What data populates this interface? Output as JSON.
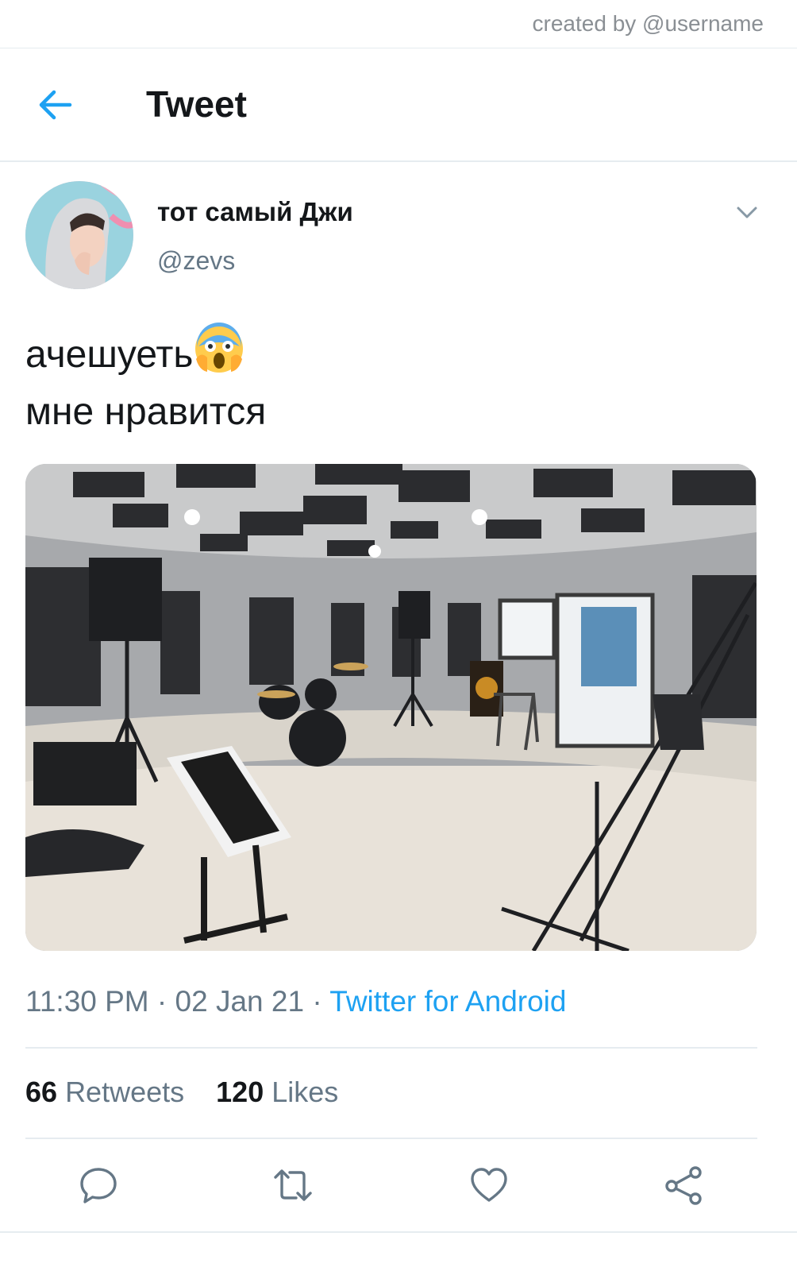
{
  "credit": "created by @username",
  "header": {
    "title": "Tweet",
    "back_icon": "arrow-left-icon"
  },
  "tweet": {
    "display_name": "тот самый Джи",
    "handle": "@zevs",
    "text_line1": "ачешуеть",
    "text_emoji": "face-screaming-in-fear-emoji",
    "text_line2": "мне нравится",
    "media_alt": "music rehearsal studio photo",
    "time": "11:30 PM",
    "date": "02 Jan 21",
    "source": "Twitter for Android",
    "retweets_count": "66",
    "retweets_label": "Retweets",
    "likes_count": "120",
    "likes_label": "Likes"
  },
  "actions": [
    "reply-icon",
    "retweet-icon",
    "like-icon",
    "share-icon"
  ],
  "colors": {
    "accent": "#1da1f2",
    "secondary_text": "#657786",
    "primary_text": "#14171a",
    "divider": "#e6ecf0"
  }
}
